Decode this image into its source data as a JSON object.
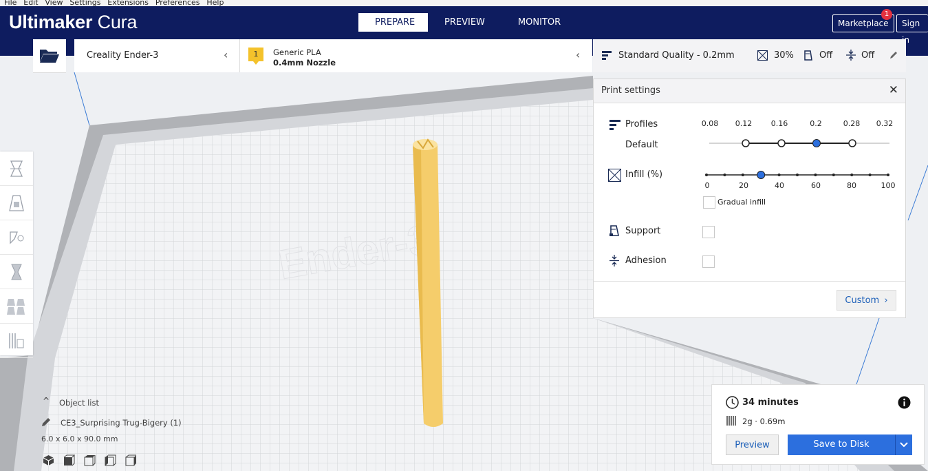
{
  "menu": [
    "File",
    "Edit",
    "View",
    "Settings",
    "Extensions",
    "Preferences",
    "Help"
  ],
  "app": {
    "brand_bold": "Ultimaker",
    "brand_thin": " Cura"
  },
  "stages": {
    "prepare": "PREPARE",
    "preview": "PREVIEW",
    "monitor": "MONITOR"
  },
  "header": {
    "marketplace": "Marketplace",
    "marketplace_badge": "1",
    "sign_in": "Sign in"
  },
  "printer": {
    "name": "Creality Ender-3"
  },
  "material": {
    "extruder_number": "1",
    "name": "Generic PLA",
    "nozzle": "0.4mm Nozzle"
  },
  "quality_bar": {
    "profile": "Standard Quality - 0.2mm",
    "infill": "30%",
    "support": "Off",
    "adhesion": "Off"
  },
  "print_settings": {
    "title": "Print settings",
    "profiles_label": "Profiles",
    "profile_default": "Default",
    "layer_heights": [
      "0.08",
      "0.12",
      "0.16",
      "0.2",
      "0.28",
      "0.32"
    ],
    "selected_layer_height": "0.2",
    "infill_label": "Infill (%)",
    "infill_ticks": [
      "0",
      "20",
      "40",
      "60",
      "80",
      "100"
    ],
    "infill_value": 30,
    "gradual_infill": "Gradual infill",
    "support_label": "Support",
    "adhesion_label": "Adhesion",
    "custom_button": "Custom"
  },
  "object_list": {
    "title": "Object list",
    "object_name": "CE3_Surprising Trug-Bigery (1)",
    "dimensions": "6.0 x 6.0 x 90.0 mm"
  },
  "job": {
    "time": "34 minutes",
    "material_usage": "2g · 0.69m",
    "preview_button": "Preview",
    "save_button": "Save to Disk"
  },
  "colors": {
    "header": "#0e1c5f",
    "accent": "#2c6fde",
    "model": "#f5cd6b",
    "badge": "#e3313f"
  }
}
